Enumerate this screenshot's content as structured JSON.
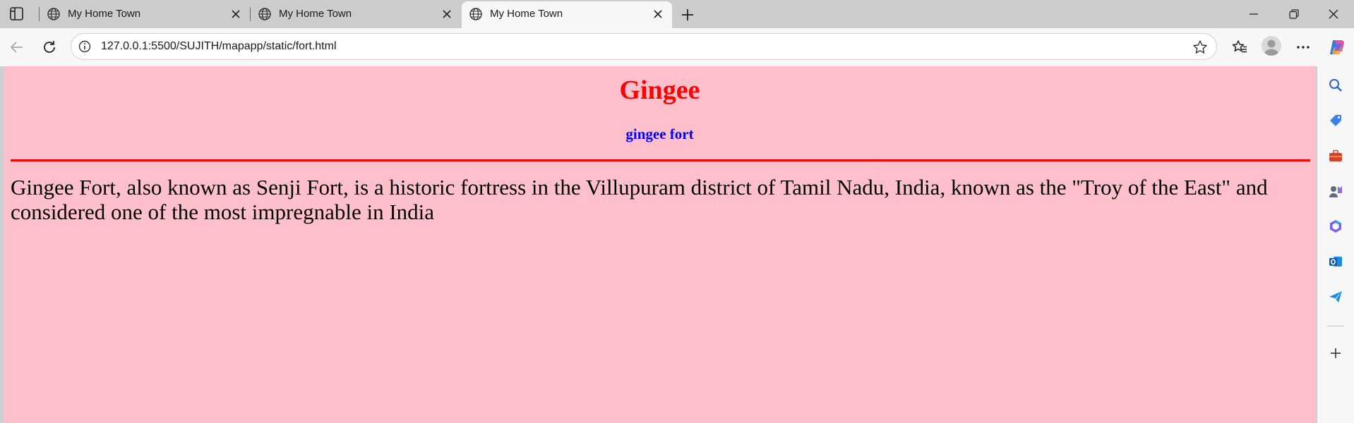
{
  "browser": {
    "tabs": [
      {
        "title": "My Home Town",
        "active": false
      },
      {
        "title": "My Home Town",
        "active": false
      },
      {
        "title": "My Home Town",
        "active": true
      }
    ],
    "address_bar": {
      "url": "127.0.0.1:5500/SUJITH/mapapp/static/fort.html"
    },
    "sidebar_icons": [
      "search-icon",
      "shopping-tag-icon",
      "tools-briefcase-icon",
      "games-icon",
      "microsoft-365-icon",
      "outlook-icon",
      "send-icon",
      "add-icon"
    ]
  },
  "page": {
    "background": "#ffc0cb",
    "heading": "Gingee",
    "heading_color": "#ff0000",
    "subheading": "gingee fort",
    "subheading_color": "#0000ff",
    "rule_color": "#ff0000",
    "paragraph": "Gingee Fort, also known as Senji Fort, is a historic fortress in the Villupuram district of Tamil Nadu, India, known as the \"Troy of the East\" and considered one of the most impregnable in India"
  }
}
